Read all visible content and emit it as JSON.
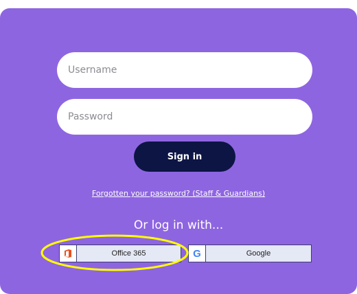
{
  "login": {
    "username_placeholder": "Username",
    "password_placeholder": "Password",
    "signin_label": "Sign in",
    "forgot_link": "Forgotten your password? (Staff & Guardians)",
    "or_login_text": "Or log in with...",
    "sso": [
      {
        "label": "Office 365",
        "icon": "office-365-icon"
      },
      {
        "label": "Google",
        "icon": "google-icon"
      }
    ]
  },
  "colors": {
    "panel": "#8e65e1",
    "signin_bg": "#0d1544",
    "sso_bg": "#e5e8f5",
    "highlight": "#ffff00"
  }
}
